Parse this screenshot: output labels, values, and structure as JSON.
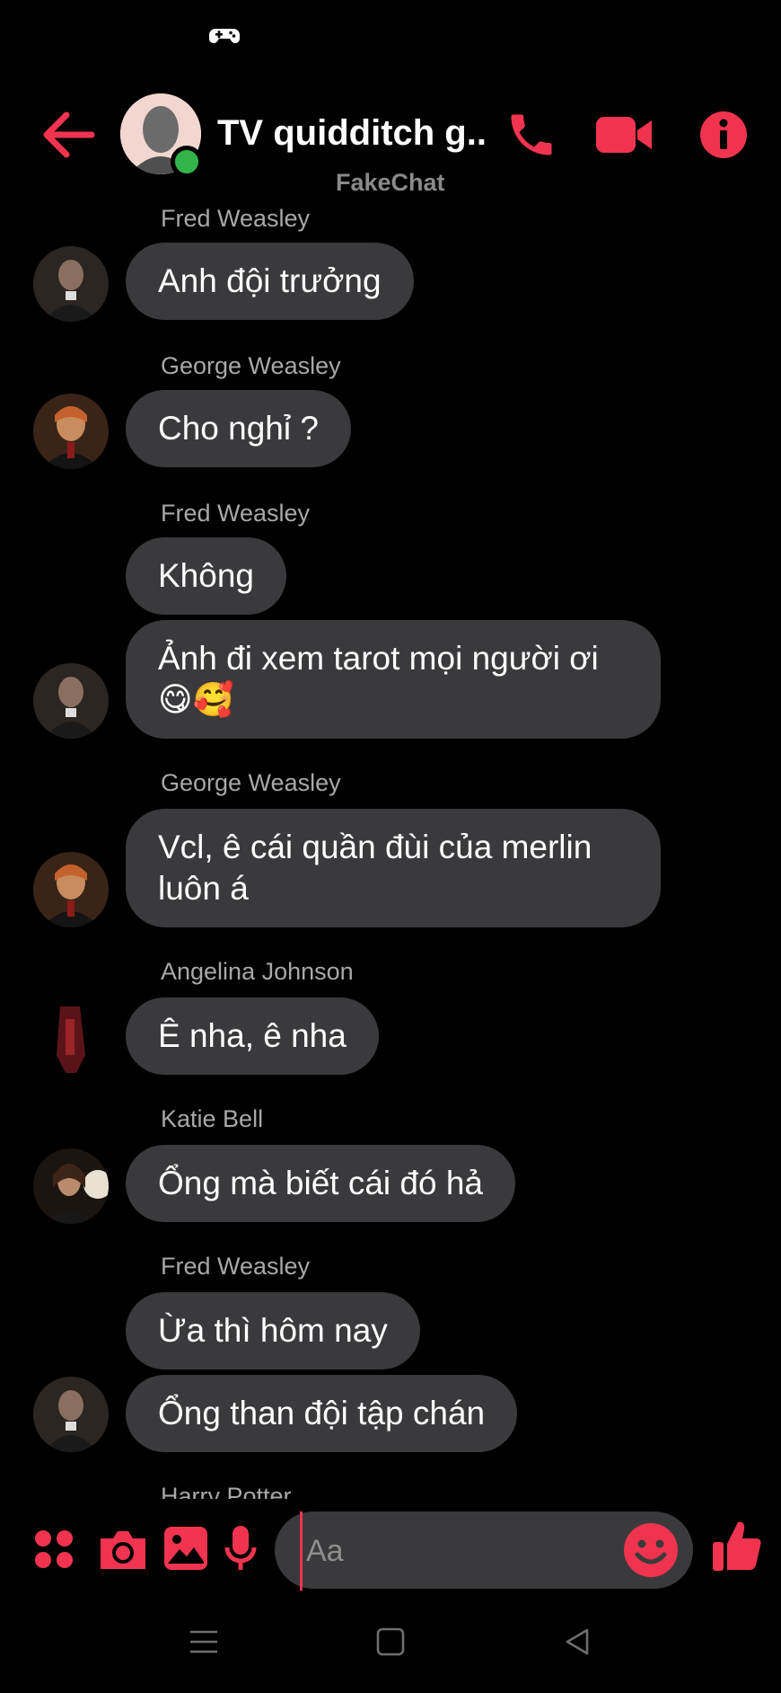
{
  "colors": {
    "accent": "#f0344f",
    "bubble": "#3a3a3c",
    "online": "#31b54a",
    "sender": "#a8a8a8"
  },
  "header": {
    "title": "TV quidditch g...",
    "subtitle": "FakeChat"
  },
  "messages": [
    {
      "sender": "Fred Weasley",
      "text": "Anh đội trưởng",
      "avatar": "fred-avatar"
    },
    {
      "sender": "George Weasley",
      "text": "Cho nghỉ ?",
      "avatar": "george-avatar"
    },
    {
      "sender": "Fred Weasley",
      "text": "Không"
    },
    {
      "text": "Ảnh đi xem tarot mọi người ơi",
      "emoji": "😋🥰",
      "avatar": "fred-avatar"
    },
    {
      "sender": "George Weasley",
      "text": "Vcl, ê cái quần đùi của merlin luôn á",
      "avatar": "george-avatar"
    },
    {
      "sender": "Angelina Johnson",
      "text": "Ê nha, ê nha",
      "avatar": "angelina-avatar"
    },
    {
      "sender": "Katie Bell",
      "text": "Ổng mà biết cái đó hả",
      "avatar": "katie-avatar"
    },
    {
      "sender": "Fred Weasley",
      "text": "Ừa thì hôm nay"
    },
    {
      "text": "Ổng than đội tập chán",
      "avatar": "fred-avatar"
    },
    {
      "sender": "Harry Potter"
    }
  ],
  "composer": {
    "placeholder": "Aa"
  },
  "icons": {
    "status": "game-controller-icon",
    "back": "back-arrow-icon",
    "call": "phone-icon",
    "video": "video-camera-icon",
    "info": "info-icon",
    "apps": "four-dots-icon",
    "camera": "camera-icon",
    "gallery": "image-icon",
    "mic": "microphone-icon",
    "emoji": "smiley-icon",
    "like": "thumbs-up-icon"
  }
}
